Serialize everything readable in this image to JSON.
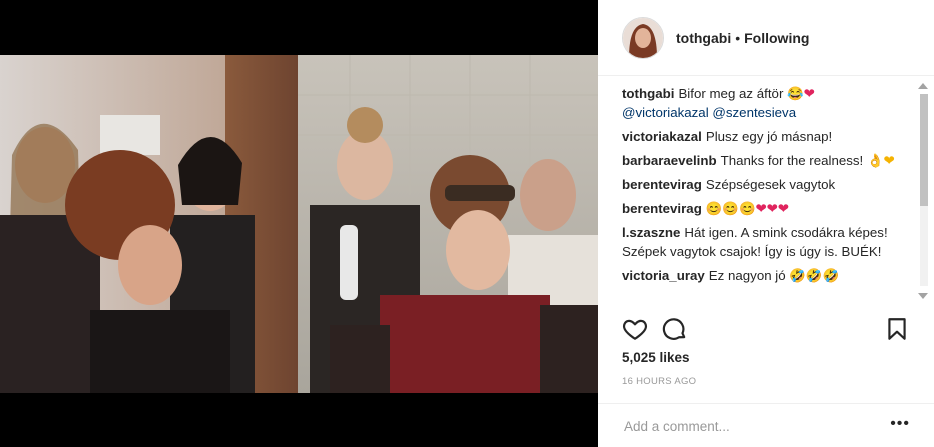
{
  "post": {
    "username": "tothgabi",
    "separator": "•",
    "follow_label": "Following",
    "likes": "5,025 likes",
    "timestamp": "16 HOURS AGO",
    "comment_placeholder": "Add a comment...",
    "more_label": "•••"
  },
  "caption": {
    "username": "tothgabi",
    "text": "Bifor meg az áftör",
    "emoji": "😂❤",
    "mentions": [
      "@victoriakazal",
      "@szentesieva"
    ]
  },
  "comments": [
    {
      "username": "victoriakazal",
      "text": "Plusz egy jó másnap!"
    },
    {
      "username": "barbaraevelinb",
      "text": "Thanks for the realness!",
      "emoji": "👌❤"
    },
    {
      "username": "berentevirag",
      "text": "Szépségesek vagytok"
    },
    {
      "username": "berentevirag",
      "text": "",
      "emoji_yellow": "😊😊😊",
      "emoji_red": "❤❤❤"
    },
    {
      "username": "l.szaszne",
      "text": "Hát igen. A smink csodákra képes! Szépek vagytok csajok! Így is úgy is. BUÉK!"
    },
    {
      "username": "victoria_uray",
      "text": "Ez nagyon jó",
      "emoji": "🤣🤣🤣"
    }
  ],
  "icons": {
    "like": "heart-icon",
    "comment": "comment-icon",
    "save": "bookmark-icon"
  },
  "colors": {
    "mention": "#003569",
    "text": "#262626",
    "muted": "#999999"
  }
}
